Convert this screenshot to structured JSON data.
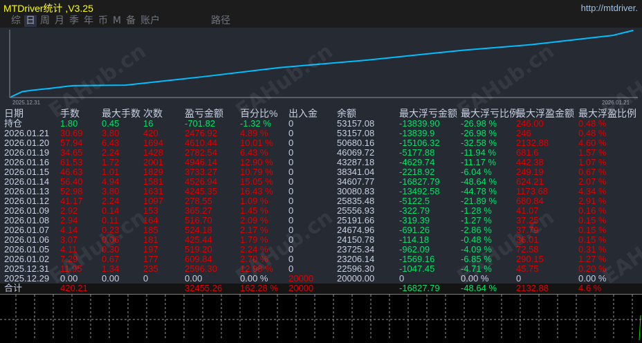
{
  "window": {
    "title": "MTDriver统计 ,V3.25",
    "url": "http://mtdriver."
  },
  "tabs": [
    {
      "label": "综",
      "active": false
    },
    {
      "label": "日",
      "active": true
    },
    {
      "label": "周",
      "active": false
    },
    {
      "label": "月",
      "active": false
    },
    {
      "label": "季",
      "active": false
    },
    {
      "label": "年",
      "active": false
    },
    {
      "label": "币",
      "active": false
    },
    {
      "label": "M",
      "active": false
    },
    {
      "label": "备",
      "active": false
    },
    {
      "label": "账户",
      "active": false
    },
    {
      "label": "",
      "active": false
    },
    {
      "label": "路径",
      "active": false
    }
  ],
  "watermark": "EAHub.cn",
  "chart_data": {
    "type": "line",
    "x_start_label": "2025.12.31",
    "x_end_label": "2026.01.21",
    "line_color": "#00bfff",
    "points": [
      {
        "date": "2025.12.29",
        "balance": 20000.0,
        "trades": 0
      },
      {
        "date": "2025.12.31",
        "balance": 22596.3,
        "trades": 235
      },
      {
        "date": "2026.01.02",
        "balance": 23206.14,
        "trades": 177
      },
      {
        "date": "2026.01.05",
        "balance": 23725.34,
        "trades": 197
      },
      {
        "date": "2026.01.06",
        "balance": 24150.78,
        "trades": 181
      },
      {
        "date": "2026.01.07",
        "balance": 24674.96,
        "trades": 185
      },
      {
        "date": "2026.01.08",
        "balance": 25191.66,
        "trades": 164
      },
      {
        "date": "2026.01.09",
        "balance": 25556.93,
        "trades": 153
      },
      {
        "date": "2026.01.12",
        "balance": 25835.48,
        "trades": 1097
      },
      {
        "date": "2026.01.13",
        "balance": 30080.83,
        "trades": 1631
      },
      {
        "date": "2026.01.14",
        "balance": 34607.77,
        "trades": 1581
      },
      {
        "date": "2026.01.15",
        "balance": 38341.04,
        "trades": 1829
      },
      {
        "date": "2026.01.16",
        "balance": 43287.18,
        "trades": 2001
      },
      {
        "date": "2026.01.19",
        "balance": 46069.72,
        "trades": 1428
      },
      {
        "date": "2026.01.20",
        "balance": 50680.16,
        "trades": 1694
      },
      {
        "date": "2026.01.21",
        "balance": 53157.08,
        "trades": 420
      }
    ]
  },
  "table": {
    "headers": [
      "日期",
      "手数",
      "最大手数",
      "次数",
      "盈亏金额",
      "百分比%",
      "出入金",
      "余额",
      "最大浮亏金额",
      "最大浮亏比例",
      "最大浮盈金额",
      "最大浮盈比例"
    ],
    "rows": [
      [
        "持仓",
        "1.80",
        "0.45",
        "16",
        "-701.82",
        "-1.32 %",
        "0",
        "53157.08",
        "-13839.90",
        "-26.98 %",
        "246.00",
        "0.48 %"
      ],
      [
        "2026.01.21",
        "30.69",
        "3.80",
        "420",
        "2476.92",
        "4.89 %",
        "0",
        "53157.08",
        "-13839.9",
        "-26.98 %",
        "246",
        "0.48 %"
      ],
      [
        "2026.01.20",
        "57.94",
        "6.43",
        "1694",
        "4610.44",
        "10.01 %",
        "0",
        "50680.16",
        "-15106.32",
        "-32.58 %",
        "2132.88",
        "4.60 %"
      ],
      [
        "2026.01.19",
        "34.65",
        "2.24",
        "1428",
        "2782.54",
        "6.43 %",
        "0",
        "46069.72",
        "-5177.88",
        "-11.94 %",
        "681.6",
        "1.57 %"
      ],
      [
        "2026.01.16",
        "61.53",
        "1.72",
        "2001",
        "4946.14",
        "12.90 %",
        "0",
        "43287.18",
        "-4629.74",
        "-11.17 %",
        "442.38",
        "1.07 %"
      ],
      [
        "2026.01.15",
        "46.63",
        "1.01",
        "1829",
        "3733.27",
        "10.79 %",
        "0",
        "38341.04",
        "-2218.92",
        "-6.04 %",
        "249.19",
        "0.67 %"
      ],
      [
        "2026.01.14",
        "56.40",
        "4.94",
        "1581",
        "4526.94",
        "15.05 %",
        "0",
        "34607.77",
        "-16827.79",
        "-48.64 %",
        "624.21",
        "2.07 %"
      ],
      [
        "2026.01.13",
        "52.98",
        "3.80",
        "1631",
        "4245.35",
        "16.43 %",
        "0",
        "30080.83",
        "-13492.58",
        "-44.78 %",
        "1173.68",
        "4.34 %"
      ],
      [
        "2026.01.12",
        "41.17",
        "2.24",
        "1097",
        "278.55",
        "1.09 %",
        "0",
        "25835.48",
        "-5122.5",
        "-21.89 %",
        "680.84",
        "2.91 %"
      ],
      [
        "2026.01.09",
        "2.92",
        "0.14",
        "153",
        "365.27",
        "1.45 %",
        "0",
        "25556.93",
        "-322.79",
        "-1.28 %",
        "41.07",
        "0.16 %"
      ],
      [
        "2026.01.08",
        "2.94",
        "0.11",
        "164",
        "516.70",
        "2.09 %",
        "0",
        "25191.66",
        "-319.39",
        "-1.27 %",
        "37.25",
        "0.15 %"
      ],
      [
        "2026.01.07",
        "4.14",
        "0.23",
        "185",
        "524.18",
        "2.17 %",
        "0",
        "24674.96",
        "-691.26",
        "-2.86 %",
        "37.79",
        "0.15 %"
      ],
      [
        "2026.01.06",
        "3.07",
        "0.06",
        "181",
        "425.44",
        "1.79 %",
        "0",
        "24150.78",
        "-114.18",
        "-0.48 %",
        "36.01",
        "0.15 %"
      ],
      [
        "2026.01.05",
        "4.11",
        "0.30",
        "197",
        "519.20",
        "2.24 %",
        "0",
        "23725.34",
        "-962.09",
        "-4.09 %",
        "72.58",
        "0.31 %"
      ],
      [
        "2026.01.02",
        "7.29",
        "0.67",
        "177",
        "609.84",
        "2.70 %",
        "0",
        "23206.14",
        "-1569.16",
        "-6.85 %",
        "290.15",
        "1.27 %"
      ],
      [
        "2025.12.31",
        "11.95",
        "1.34",
        "235",
        "2596.30",
        "12.98 %",
        "0",
        "22596.30",
        "-1047.45",
        "-4.71 %",
        "45.75",
        "0.20 %"
      ],
      [
        "2025.12.29",
        "0.00",
        "0.00",
        "0",
        "0.00",
        "0.00 %",
        "20000",
        "20000.00",
        "0",
        "0.00 %",
        "0",
        "0.00 %"
      ]
    ],
    "total": [
      "合计",
      "420.21",
      "",
      "",
      "32455.26",
      "162.28 %",
      "20000",
      "",
      "-16827.79",
      "-48.64 %",
      "2132.88",
      "4.6 %"
    ]
  },
  "colors": {
    "text": "#c8d2e4",
    "positive": "#e00000",
    "negative": "#00e468",
    "title": "#ffff00"
  }
}
